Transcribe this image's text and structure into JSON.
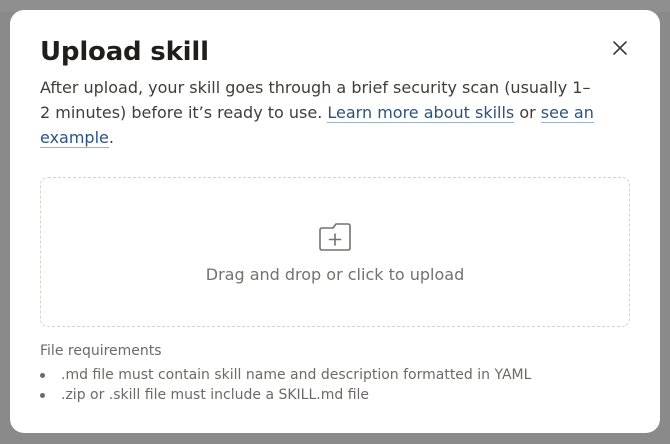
{
  "dialog": {
    "title": "Upload skill",
    "description_before": "After upload, your skill goes through a brief security scan (usually 1–2 minutes) before it’s ready to use. ",
    "learn_more_link": "Learn more about skills",
    "connector": " or ",
    "example_link": "see an example",
    "description_end": ".",
    "close_icon": "close-icon"
  },
  "dropzone": {
    "icon": "folder-plus-icon",
    "label": "Drag and drop or click to upload"
  },
  "requirements": {
    "title": "File requirements",
    "items": [
      ".md file must contain skill name and description formatted in YAML",
      ".zip or .skill file must include a SKILL.md file"
    ]
  },
  "colors": {
    "link": "#2c5282",
    "title": "#1f1e1d",
    "muted": "#73726c"
  }
}
